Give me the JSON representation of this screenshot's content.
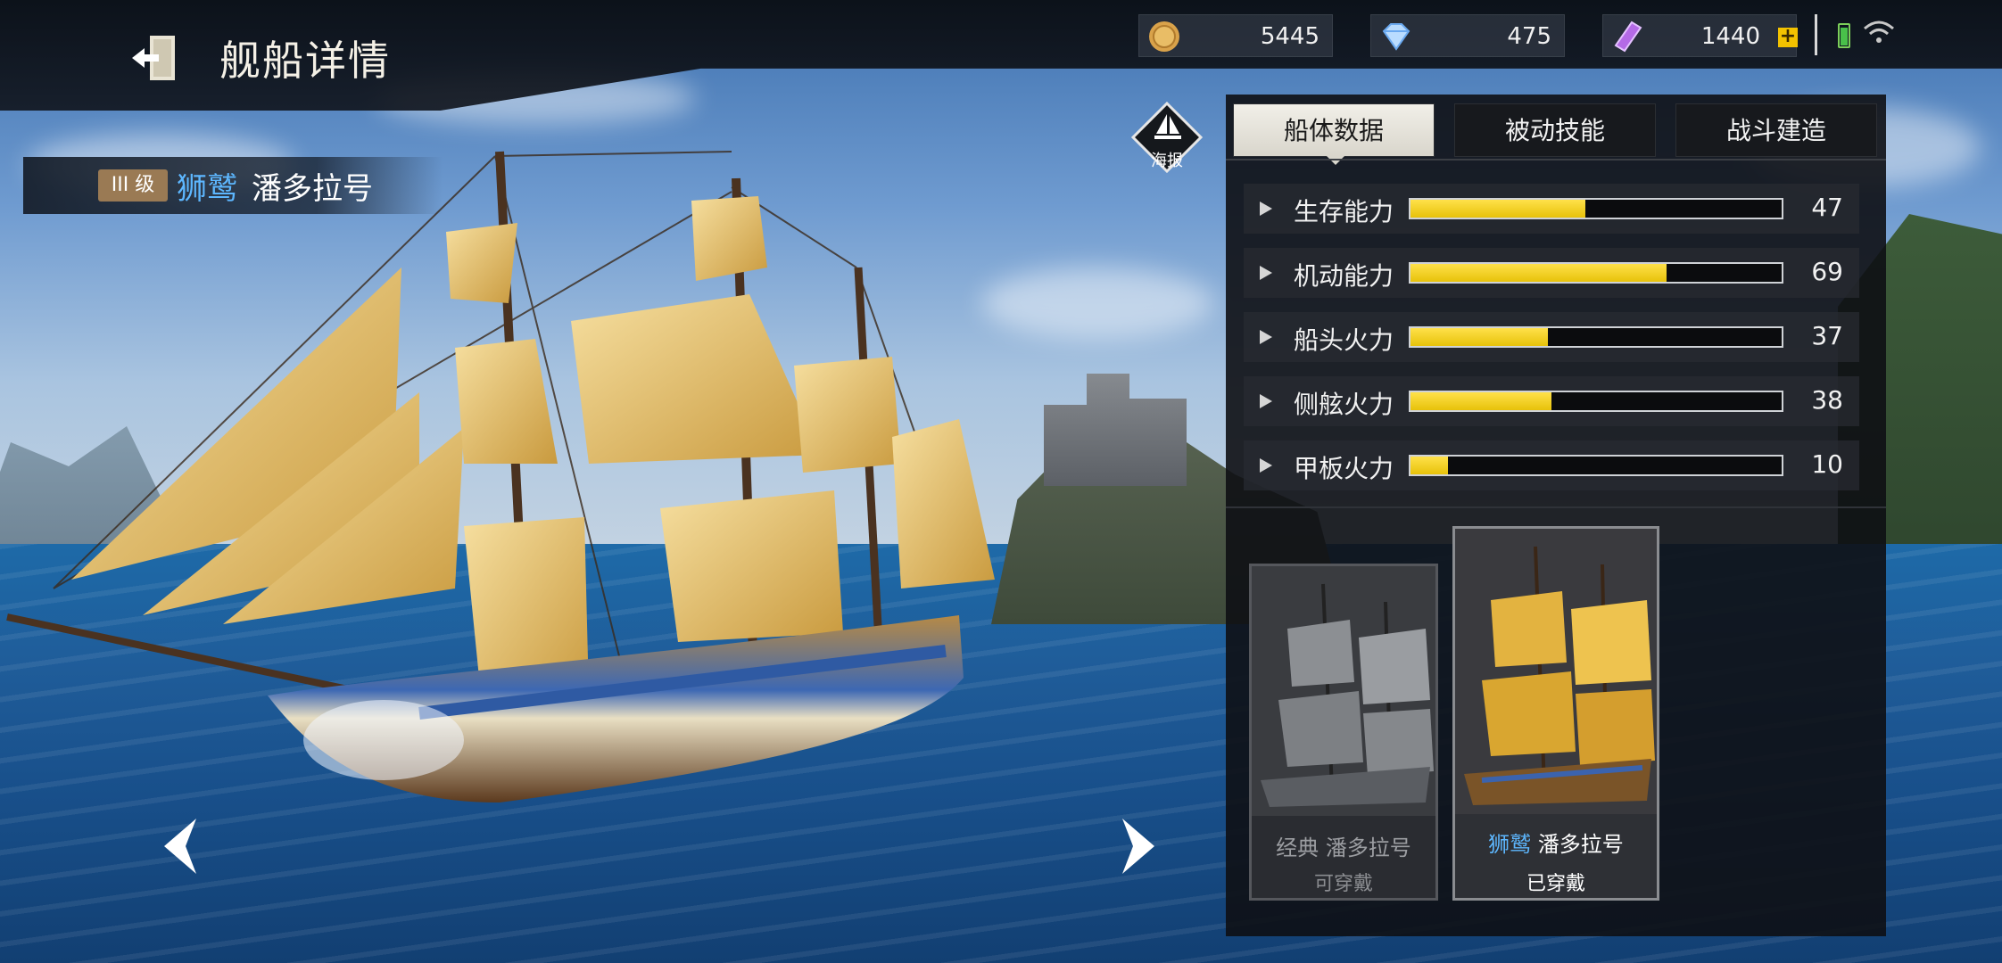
{
  "header": {
    "title": "舰船详情",
    "resources": [
      {
        "icon": "gold-coin-icon",
        "value": "5445"
      },
      {
        "icon": "diamond-icon",
        "value": "475"
      },
      {
        "icon": "purple-ticket-icon",
        "value": "1440"
      }
    ]
  },
  "ship": {
    "tier": "III 级",
    "class": "狮鹫",
    "name": "潘多拉号"
  },
  "poster": {
    "label": "海报"
  },
  "tabs": [
    {
      "label": "船体数据",
      "active": true
    },
    {
      "label": "被动技能",
      "active": false
    },
    {
      "label": "战斗建造",
      "active": false
    }
  ],
  "stats": [
    {
      "label": "生存能力",
      "value": "47",
      "percent": 47
    },
    {
      "label": "机动能力",
      "value": "69",
      "percent": 69
    },
    {
      "label": "船头火力",
      "value": "37",
      "percent": 37
    },
    {
      "label": "侧舷火力",
      "value": "38",
      "percent": 38
    },
    {
      "label": "甲板火力",
      "value": "10",
      "percent": 10
    }
  ],
  "skins": [
    {
      "prefix": "经典",
      "name": "潘多拉号",
      "status": "可穿戴",
      "equipped": false
    },
    {
      "prefix": "狮鹫",
      "name": "潘多拉号",
      "status": "已穿戴",
      "equipped": true
    }
  ],
  "colors": {
    "accent_blue": "#5db7ff",
    "bar_fill": "#f0cd1c",
    "panel_bg": "#0e1014"
  }
}
